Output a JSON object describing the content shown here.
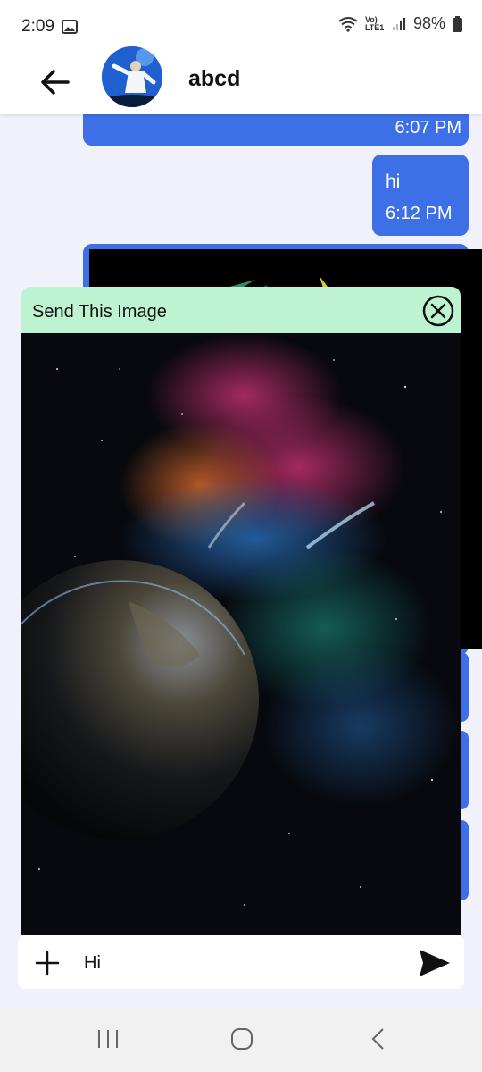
{
  "status_bar": {
    "time": "2:09",
    "battery": "98%",
    "network_label": "Vo) LTE1"
  },
  "header": {
    "contact_name": "abcd"
  },
  "messages": [
    {
      "time": "6:07 PM"
    },
    {
      "text": "hi",
      "time": "6:12 PM"
    }
  ],
  "image_modal": {
    "title": "Send This Image"
  },
  "composer": {
    "value": "Hi"
  },
  "colors": {
    "bubble": "#3d6fe6",
    "modal_header": "#bdf3d0",
    "background": "#f1f1fb"
  },
  "icons": [
    "gallery-icon",
    "wifi-icon",
    "signal-icon",
    "battery-icon",
    "back-arrow-icon",
    "close-icon",
    "plus-icon",
    "send-icon",
    "recents-icon",
    "home-icon",
    "nav-back-icon"
  ]
}
